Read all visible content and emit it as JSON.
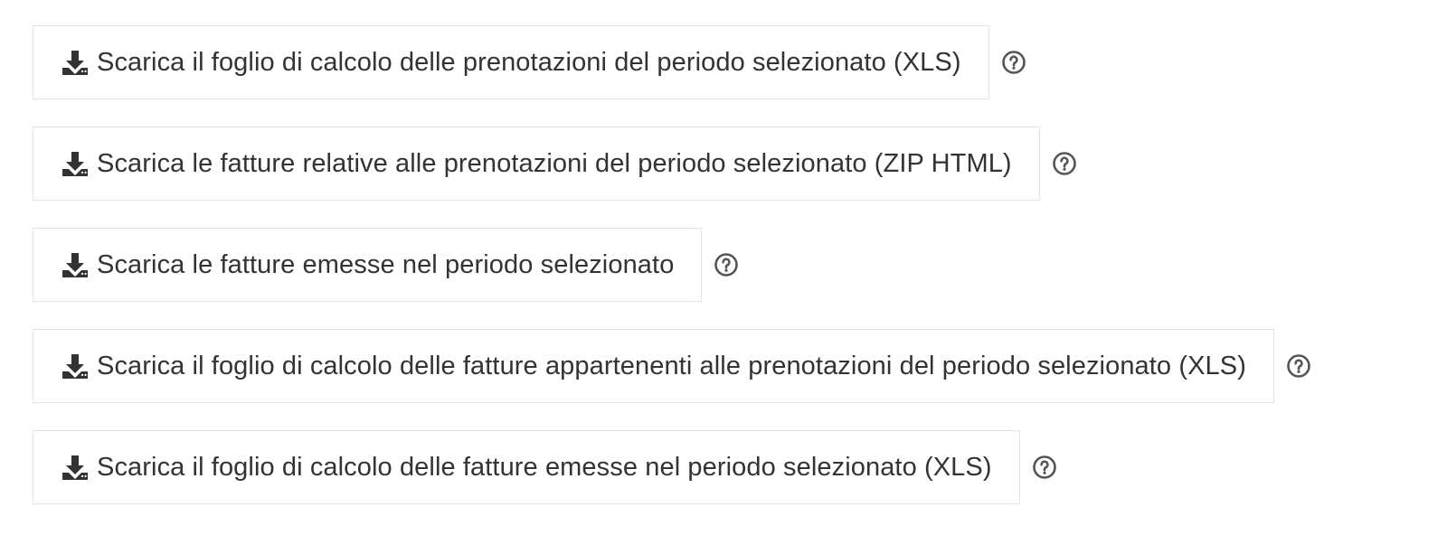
{
  "colors": {
    "text": "#333333",
    "border": "#e3e3e3",
    "icon": "#333333",
    "help_icon": "#555555"
  },
  "icons": {
    "download": "download-icon",
    "help": "question-circle-icon"
  },
  "downloads": [
    {
      "label": "Scarica il foglio di calcolo delle prenotazioni del periodo selezionato (XLS)"
    },
    {
      "label": "Scarica le fatture relative alle prenotazioni del periodo selezionato (ZIP HTML)"
    },
    {
      "label": "Scarica le fatture emesse nel periodo selezionato"
    },
    {
      "label": "Scarica il foglio di calcolo delle fatture appartenenti alle prenotazioni del periodo selezionato (XLS)"
    },
    {
      "label": "Scarica il foglio di calcolo delle fatture emesse nel periodo selezionato (XLS)"
    }
  ]
}
